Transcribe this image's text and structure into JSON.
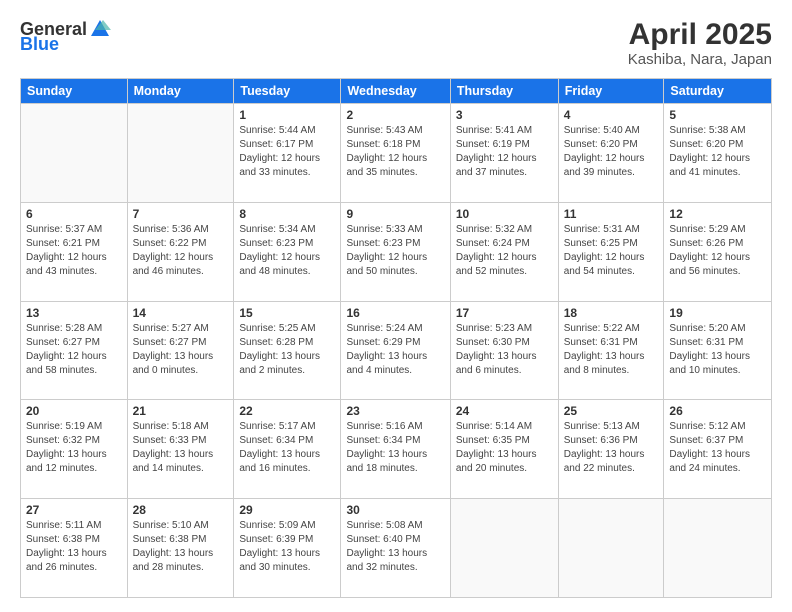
{
  "logo": {
    "general": "General",
    "blue": "Blue"
  },
  "header": {
    "title": "April 2025",
    "subtitle": "Kashiba, Nara, Japan"
  },
  "weekdays": [
    "Sunday",
    "Monday",
    "Tuesday",
    "Wednesday",
    "Thursday",
    "Friday",
    "Saturday"
  ],
  "weeks": [
    [
      {
        "day": "",
        "info": ""
      },
      {
        "day": "",
        "info": ""
      },
      {
        "day": "1",
        "info": "Sunrise: 5:44 AM\nSunset: 6:17 PM\nDaylight: 12 hours and 33 minutes."
      },
      {
        "day": "2",
        "info": "Sunrise: 5:43 AM\nSunset: 6:18 PM\nDaylight: 12 hours and 35 minutes."
      },
      {
        "day": "3",
        "info": "Sunrise: 5:41 AM\nSunset: 6:19 PM\nDaylight: 12 hours and 37 minutes."
      },
      {
        "day": "4",
        "info": "Sunrise: 5:40 AM\nSunset: 6:20 PM\nDaylight: 12 hours and 39 minutes."
      },
      {
        "day": "5",
        "info": "Sunrise: 5:38 AM\nSunset: 6:20 PM\nDaylight: 12 hours and 41 minutes."
      }
    ],
    [
      {
        "day": "6",
        "info": "Sunrise: 5:37 AM\nSunset: 6:21 PM\nDaylight: 12 hours and 43 minutes."
      },
      {
        "day": "7",
        "info": "Sunrise: 5:36 AM\nSunset: 6:22 PM\nDaylight: 12 hours and 46 minutes."
      },
      {
        "day": "8",
        "info": "Sunrise: 5:34 AM\nSunset: 6:23 PM\nDaylight: 12 hours and 48 minutes."
      },
      {
        "day": "9",
        "info": "Sunrise: 5:33 AM\nSunset: 6:23 PM\nDaylight: 12 hours and 50 minutes."
      },
      {
        "day": "10",
        "info": "Sunrise: 5:32 AM\nSunset: 6:24 PM\nDaylight: 12 hours and 52 minutes."
      },
      {
        "day": "11",
        "info": "Sunrise: 5:31 AM\nSunset: 6:25 PM\nDaylight: 12 hours and 54 minutes."
      },
      {
        "day": "12",
        "info": "Sunrise: 5:29 AM\nSunset: 6:26 PM\nDaylight: 12 hours and 56 minutes."
      }
    ],
    [
      {
        "day": "13",
        "info": "Sunrise: 5:28 AM\nSunset: 6:27 PM\nDaylight: 12 hours and 58 minutes."
      },
      {
        "day": "14",
        "info": "Sunrise: 5:27 AM\nSunset: 6:27 PM\nDaylight: 13 hours and 0 minutes."
      },
      {
        "day": "15",
        "info": "Sunrise: 5:25 AM\nSunset: 6:28 PM\nDaylight: 13 hours and 2 minutes."
      },
      {
        "day": "16",
        "info": "Sunrise: 5:24 AM\nSunset: 6:29 PM\nDaylight: 13 hours and 4 minutes."
      },
      {
        "day": "17",
        "info": "Sunrise: 5:23 AM\nSunset: 6:30 PM\nDaylight: 13 hours and 6 minutes."
      },
      {
        "day": "18",
        "info": "Sunrise: 5:22 AM\nSunset: 6:31 PM\nDaylight: 13 hours and 8 minutes."
      },
      {
        "day": "19",
        "info": "Sunrise: 5:20 AM\nSunset: 6:31 PM\nDaylight: 13 hours and 10 minutes."
      }
    ],
    [
      {
        "day": "20",
        "info": "Sunrise: 5:19 AM\nSunset: 6:32 PM\nDaylight: 13 hours and 12 minutes."
      },
      {
        "day": "21",
        "info": "Sunrise: 5:18 AM\nSunset: 6:33 PM\nDaylight: 13 hours and 14 minutes."
      },
      {
        "day": "22",
        "info": "Sunrise: 5:17 AM\nSunset: 6:34 PM\nDaylight: 13 hours and 16 minutes."
      },
      {
        "day": "23",
        "info": "Sunrise: 5:16 AM\nSunset: 6:34 PM\nDaylight: 13 hours and 18 minutes."
      },
      {
        "day": "24",
        "info": "Sunrise: 5:14 AM\nSunset: 6:35 PM\nDaylight: 13 hours and 20 minutes."
      },
      {
        "day": "25",
        "info": "Sunrise: 5:13 AM\nSunset: 6:36 PM\nDaylight: 13 hours and 22 minutes."
      },
      {
        "day": "26",
        "info": "Sunrise: 5:12 AM\nSunset: 6:37 PM\nDaylight: 13 hours and 24 minutes."
      }
    ],
    [
      {
        "day": "27",
        "info": "Sunrise: 5:11 AM\nSunset: 6:38 PM\nDaylight: 13 hours and 26 minutes."
      },
      {
        "day": "28",
        "info": "Sunrise: 5:10 AM\nSunset: 6:38 PM\nDaylight: 13 hours and 28 minutes."
      },
      {
        "day": "29",
        "info": "Sunrise: 5:09 AM\nSunset: 6:39 PM\nDaylight: 13 hours and 30 minutes."
      },
      {
        "day": "30",
        "info": "Sunrise: 5:08 AM\nSunset: 6:40 PM\nDaylight: 13 hours and 32 minutes."
      },
      {
        "day": "",
        "info": ""
      },
      {
        "day": "",
        "info": ""
      },
      {
        "day": "",
        "info": ""
      }
    ]
  ]
}
